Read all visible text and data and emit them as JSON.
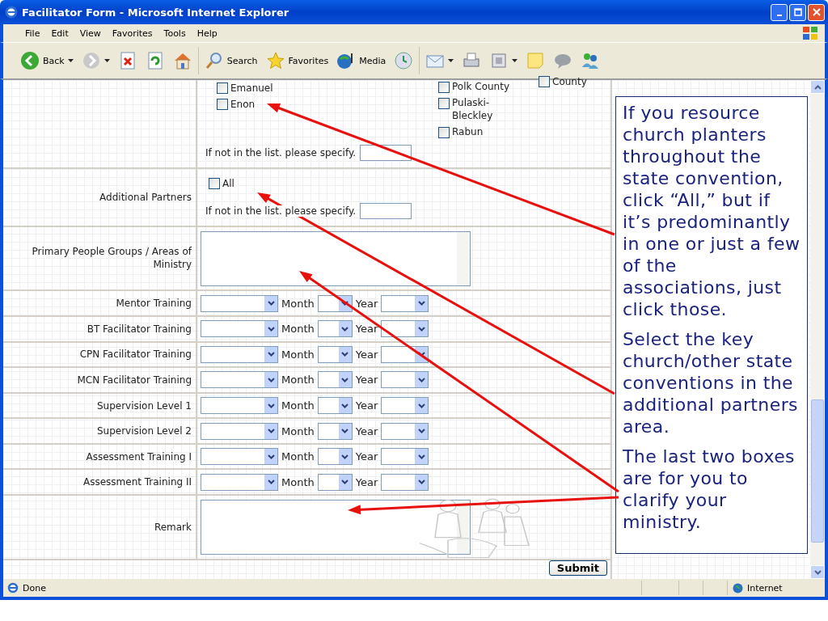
{
  "window": {
    "title": "Facilitator Form - Microsoft Internet Explorer"
  },
  "menu": [
    "File",
    "Edit",
    "View",
    "Favorites",
    "Tools",
    "Help"
  ],
  "toolbar": [
    {
      "kind": "back",
      "label": "Back",
      "caret": true
    },
    {
      "kind": "forward",
      "caret": true
    },
    {
      "kind": "stop"
    },
    {
      "kind": "refresh"
    },
    {
      "kind": "home"
    },
    {
      "kind": "search",
      "label": "Search"
    },
    {
      "kind": "favorites",
      "label": "Favorites"
    },
    {
      "kind": "media",
      "label": "Media"
    },
    {
      "kind": "history"
    },
    {
      "kind": "mail",
      "caret": true
    },
    {
      "kind": "print"
    },
    {
      "kind": "edit",
      "caret": true
    },
    {
      "kind": "note"
    },
    {
      "kind": "discuss"
    },
    {
      "kind": "messenger"
    }
  ],
  "associations": {
    "columns": [
      [
        {
          "label": "Emanuel",
          "checked": false
        },
        {
          "label": "Enon",
          "checked": false
        }
      ],
      [
        {
          "label": "Polk County",
          "checked": false
        },
        {
          "label": "Pulaski-Bleckley",
          "checked": false
        },
        {
          "label": "Rabun",
          "checked": false
        }
      ],
      [
        {
          "label": "County",
          "checked": false
        }
      ]
    ],
    "specify_label": "If not in the list. please specify."
  },
  "partners": {
    "label": "Additional Partners",
    "items": [
      {
        "label": "All",
        "checked": false
      }
    ],
    "specify_label": "If not in the list. please specify."
  },
  "people_groups": {
    "label": "Primary People Groups / Areas of Ministry"
  },
  "trainings": [
    {
      "label": "Mentor Training",
      "month_label": "Month",
      "year_label": "Year"
    },
    {
      "label": "BT Facilitator Training",
      "month_label": "Month",
      "year_label": "Year"
    },
    {
      "label": "CPN Facilitator Training",
      "month_label": "Month",
      "year_label": "Year"
    },
    {
      "label": "MCN Facilitator Training",
      "month_label": "Month",
      "year_label": "Year"
    },
    {
      "label": "Supervision Level 1",
      "month_label": "Month",
      "year_label": "Year"
    },
    {
      "label": "Supervision Level 2",
      "month_label": "Month",
      "year_label": "Year"
    },
    {
      "label": "Assessment Training I",
      "month_label": "Month",
      "year_label": "Year"
    },
    {
      "label": "Assessment Training II",
      "month_label": "Month",
      "year_label": "Year"
    }
  ],
  "remark": {
    "label": "Remark"
  },
  "submit": "Submit",
  "callout": [
    "If you resource church planters throughout the state convention, click “All,” but if it’s predominantly in one or just a few of the associations, just click those.",
    "Select the key church/other state conventions in the additional partners area.",
    "The last two boxes are for you to clarify your ministry."
  ],
  "status_bar": {
    "text": "Done",
    "zone": "Internet"
  }
}
